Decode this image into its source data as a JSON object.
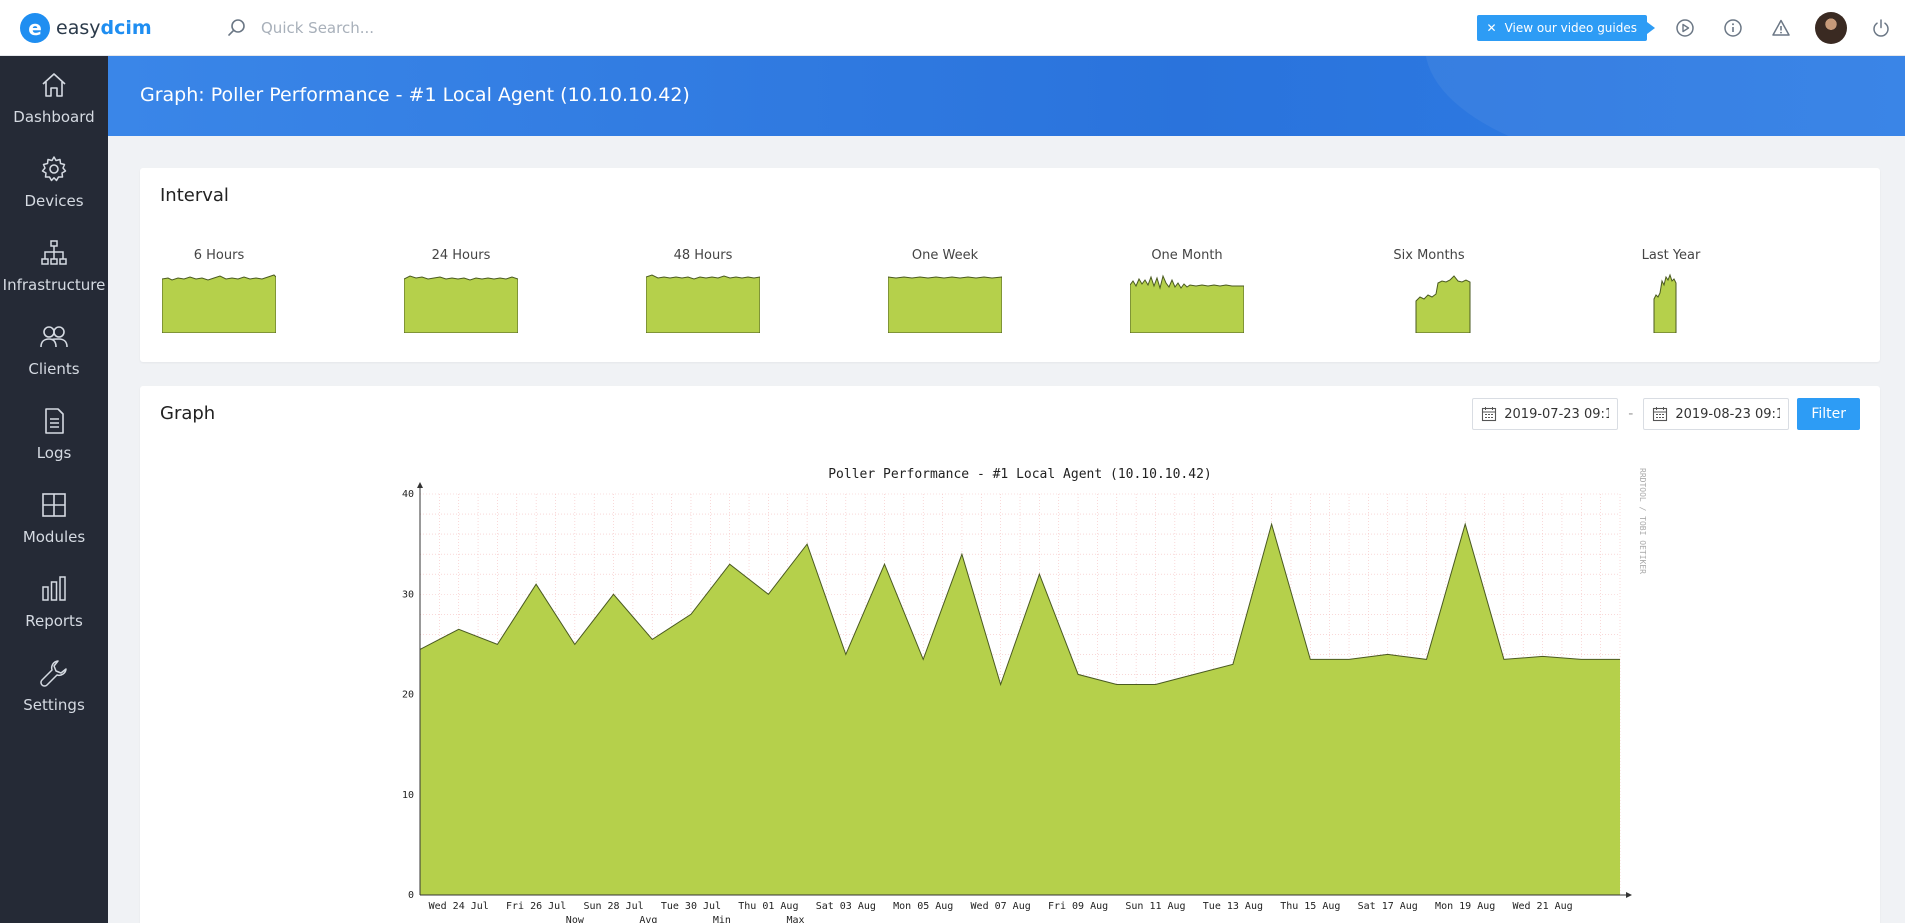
{
  "app": {
    "logo_mark": "e",
    "logo_text_pre": "easy",
    "logo_text_post": "dcim"
  },
  "search": {
    "placeholder": "Quick Search..."
  },
  "topbar": {
    "video_guides_label": "View our video guides",
    "icons": [
      "play-circle-icon",
      "info-icon",
      "alert-icon",
      "avatar",
      "power-icon"
    ]
  },
  "sidebar": {
    "items": [
      {
        "label": "Dashboard",
        "icon": "home-icon"
      },
      {
        "label": "Devices",
        "icon": "gear-icon"
      },
      {
        "label": "Infrastructure",
        "icon": "network-icon"
      },
      {
        "label": "Clients",
        "icon": "users-icon"
      },
      {
        "label": "Logs",
        "icon": "document-icon"
      },
      {
        "label": "Modules",
        "icon": "grid-icon"
      },
      {
        "label": "Reports",
        "icon": "bar-chart-icon"
      },
      {
        "label": "Settings",
        "icon": "wrench-icon"
      }
    ]
  },
  "page": {
    "title": "Graph: Poller Performance - #1 Local Agent (10.10.10.42)"
  },
  "interval": {
    "title": "Interval",
    "thumbs": [
      {
        "label": "6 Hours"
      },
      {
        "label": "24 Hours"
      },
      {
        "label": "48 Hours"
      },
      {
        "label": "One Week"
      },
      {
        "label": "One Month"
      },
      {
        "label": "Six Months"
      },
      {
        "label": "Last Year"
      }
    ]
  },
  "graph": {
    "title": "Graph",
    "date_from": "2019-07-23 09:1",
    "date_to": "2019-08-23 09:1",
    "range_separator": "-",
    "filter_label": "Filter"
  },
  "colors": {
    "accent": "#2d9cf5",
    "sidebar": "#252a36",
    "area_fill": "#b5d04b",
    "area_line": "#4a5a20",
    "grid": "#f5c0c0"
  },
  "chart_data": {
    "type": "area",
    "title": "Poller Performance - #1 Local Agent (10.10.10.42)",
    "watermark": "RRDTOOL / TOBI OETIKER",
    "ylim": [
      0,
      40
    ],
    "y_ticks": [
      0,
      10,
      20,
      30,
      40
    ],
    "x_tick_labels": [
      "Wed 24 Jul",
      "Fri 26 Jul",
      "Sun 28 Jul",
      "Tue 30 Jul",
      "Thu 01 Aug",
      "Sat 03 Aug",
      "Mon 05 Aug",
      "Wed 07 Aug",
      "Fri 09 Aug",
      "Sun 11 Aug",
      "Tue 13 Aug",
      "Thu 15 Aug",
      "Sat 17 Aug",
      "Mon 19 Aug",
      "Wed 21 Aug"
    ],
    "legend_fragments": [
      "Now",
      "Avg",
      "Min",
      "Max"
    ],
    "x_days": [
      0,
      1,
      2,
      3,
      4,
      5,
      6,
      7,
      8,
      9,
      10,
      11,
      12,
      13,
      14,
      15,
      16,
      17,
      18,
      19,
      20,
      21,
      22,
      23,
      24,
      25,
      26,
      27,
      28,
      29,
      30,
      31
    ],
    "x": [
      "2019-07-23",
      "2019-07-24",
      "2019-07-25",
      "2019-07-26",
      "2019-07-27",
      "2019-07-28",
      "2019-07-29",
      "2019-07-30",
      "2019-07-31",
      "2019-08-01",
      "2019-08-02",
      "2019-08-03",
      "2019-08-04",
      "2019-08-05",
      "2019-08-06",
      "2019-08-07",
      "2019-08-08",
      "2019-08-09",
      "2019-08-10",
      "2019-08-11",
      "2019-08-12",
      "2019-08-13",
      "2019-08-14",
      "2019-08-15",
      "2019-08-16",
      "2019-08-17",
      "2019-08-18",
      "2019-08-19",
      "2019-08-20",
      "2019-08-21",
      "2019-08-22",
      "2019-08-23"
    ],
    "values": [
      24.5,
      26.5,
      25,
      31,
      25,
      30,
      25.5,
      28,
      33,
      30,
      35,
      24,
      33,
      23.5,
      34,
      21,
      32,
      22,
      21,
      21,
      22,
      23,
      37,
      23.5,
      23.5,
      24,
      23.5,
      37,
      23.5,
      23.8,
      23.5,
      23.5
    ]
  }
}
